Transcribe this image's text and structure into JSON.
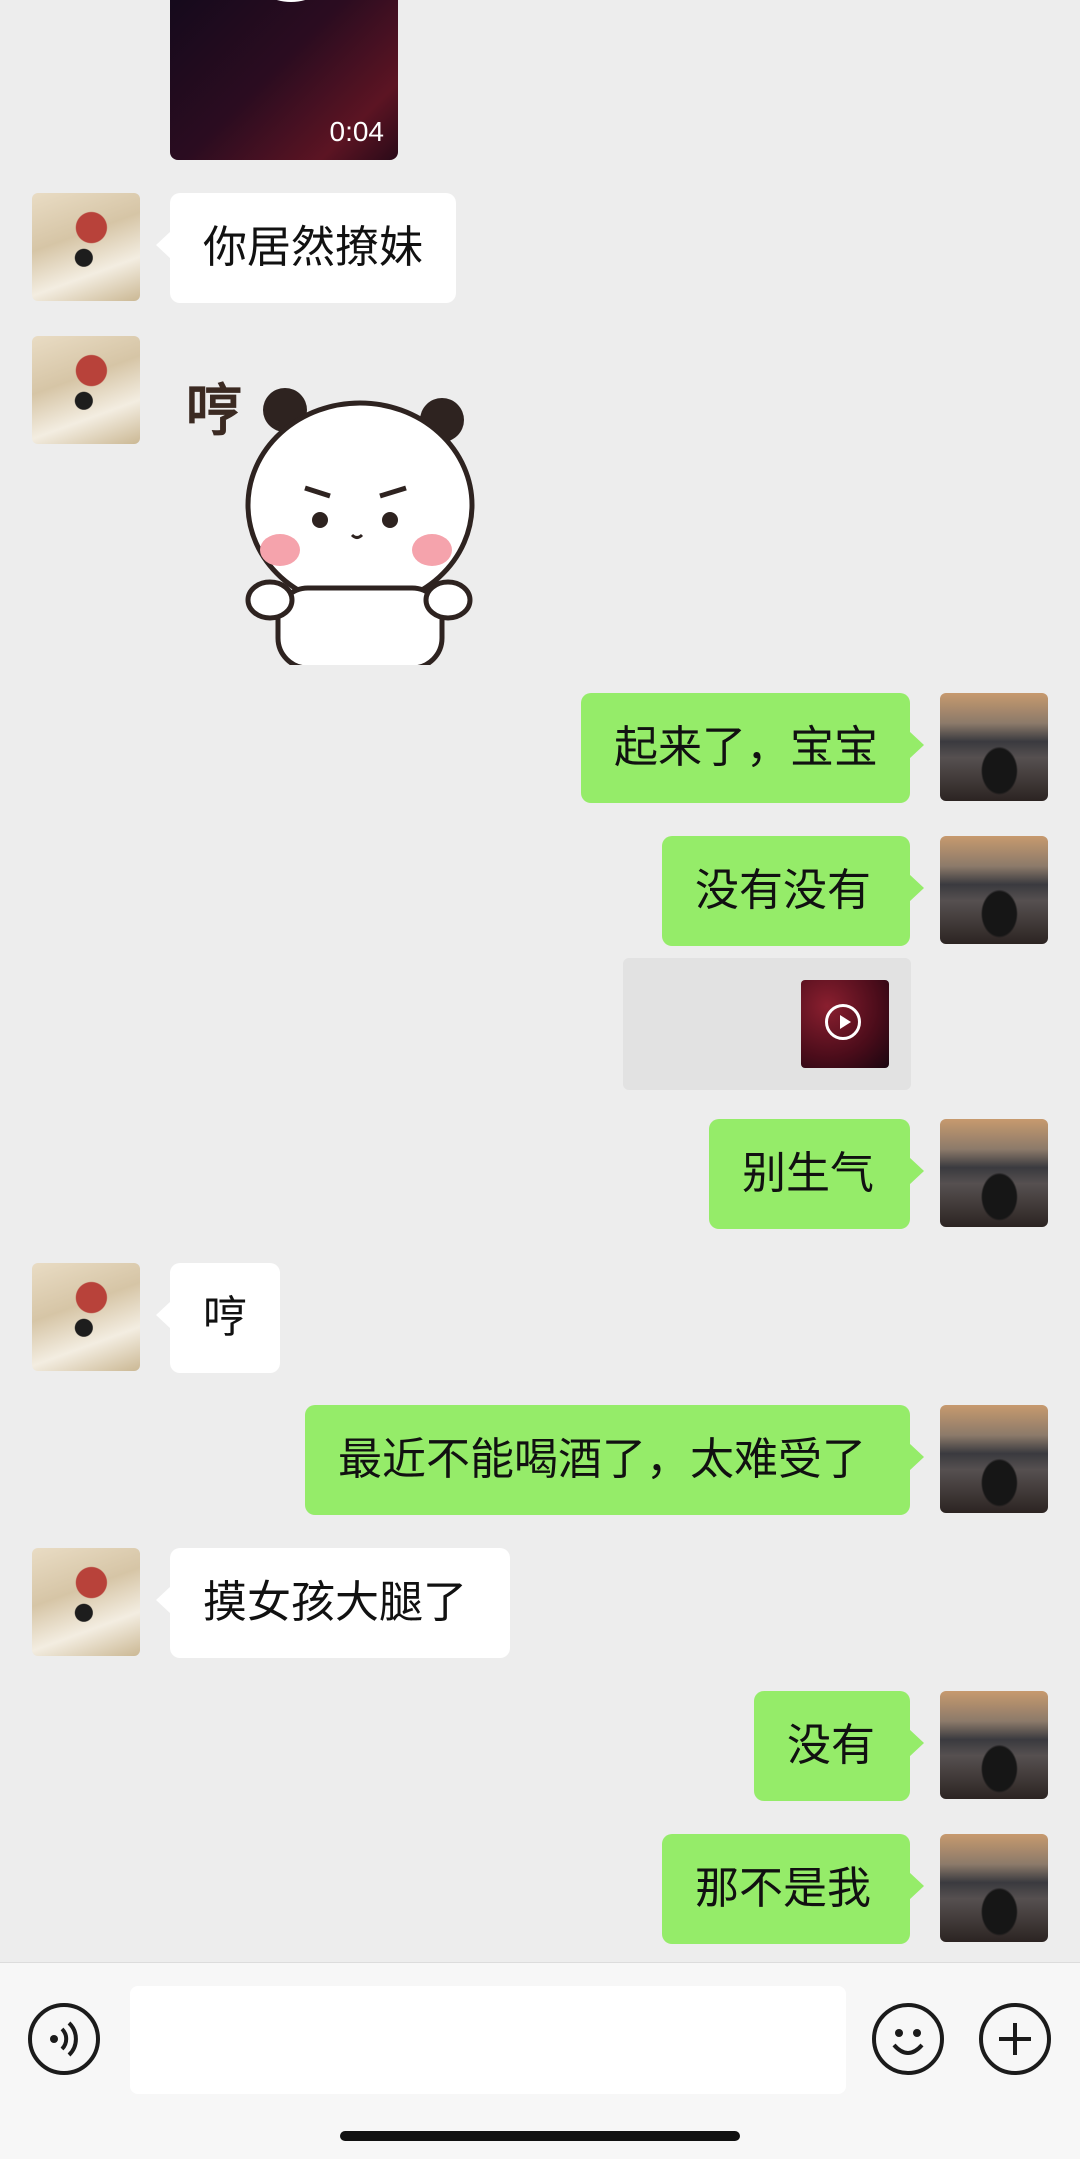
{
  "video": {
    "duration": "0:04"
  },
  "messages": [
    {
      "side": "left",
      "text": "你居然撩妹"
    },
    {
      "side": "left",
      "sticker": "panda-sticker",
      "sticker_text": "哼"
    },
    {
      "side": "right",
      "text": "起来了，宝宝"
    },
    {
      "side": "right",
      "text": "没有没有"
    },
    {
      "side": "right",
      "text": "别生气"
    },
    {
      "side": "left",
      "text": "哼"
    },
    {
      "side": "right",
      "text": "最近不能喝酒了，太难受了"
    },
    {
      "side": "left",
      "text": "摸女孩大腿了"
    },
    {
      "side": "right",
      "text": "没有"
    },
    {
      "side": "right",
      "text": "那不是我"
    }
  ],
  "icons": {
    "voice": "voice-icon",
    "emoji": "emoji-icon",
    "plus": "plus-icon",
    "play": "play-icon"
  }
}
